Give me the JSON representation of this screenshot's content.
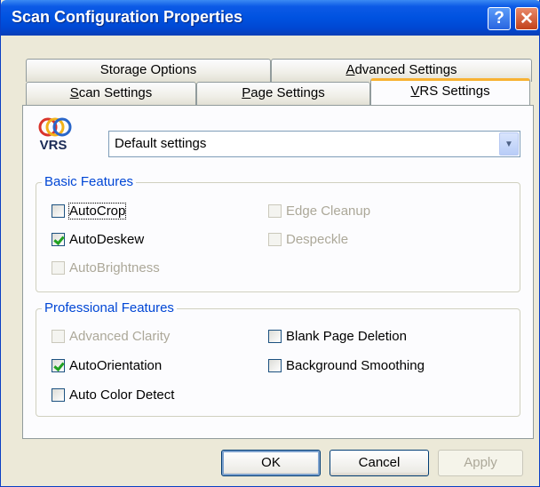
{
  "window": {
    "title": "Scan Configuration Properties",
    "help_glyph": "?",
    "close_glyph": "✕"
  },
  "tabs": {
    "row_back": [
      {
        "label": "Storage Options",
        "mnemonic_index": -1
      },
      {
        "label": "Advanced Settings",
        "mnemonic_index": 0
      }
    ],
    "row_front": [
      {
        "label": "Scan Settings",
        "mnemonic_index": 0
      },
      {
        "label": "Page Settings",
        "mnemonic_index": 0
      },
      {
        "label": "VRS Settings",
        "mnemonic_index": 0,
        "active": true
      }
    ]
  },
  "vrs": {
    "logo_text": "VRS",
    "profile_select": {
      "selected": "Default settings"
    }
  },
  "basic_features": {
    "title": "Basic Features",
    "items": {
      "autocrop": {
        "label": "AutoCrop",
        "checked": false,
        "enabled": true
      },
      "edge_cleanup": {
        "label": "Edge Cleanup",
        "checked": false,
        "enabled": false
      },
      "autodeskew": {
        "label": "AutoDeskew",
        "checked": true,
        "enabled": true
      },
      "despeckle": {
        "label": "Despeckle",
        "checked": false,
        "enabled": false
      },
      "autobrightness": {
        "label": "AutoBrightness",
        "checked": false,
        "enabled": false
      }
    }
  },
  "professional_features": {
    "title": "Professional Features",
    "items": {
      "advanced_clarity": {
        "label": "Advanced Clarity",
        "checked": false,
        "enabled": false
      },
      "blank_page_deletion": {
        "label": "Blank Page Deletion",
        "checked": false,
        "enabled": true
      },
      "autoorientation": {
        "label": "AutoOrientation",
        "checked": true,
        "enabled": true
      },
      "background_smoothing": {
        "label": "Background Smoothing",
        "checked": false,
        "enabled": true
      },
      "auto_color_detect": {
        "label": "Auto Color Detect",
        "checked": false,
        "enabled": true
      }
    }
  },
  "buttons": {
    "ok": "OK",
    "cancel": "Cancel",
    "apply": "Apply"
  },
  "colors": {
    "titlebar": "#0052e0",
    "dialog_bg": "#ece9d8",
    "group_title": "#0046d5",
    "active_tab_accent": "#f8b232",
    "check_mark": "#21a121"
  },
  "icons": {
    "vrs_logo": "vrs-logo-icon",
    "help": "help-icon",
    "close": "close-icon",
    "dropdown": "chevron-down-icon"
  }
}
